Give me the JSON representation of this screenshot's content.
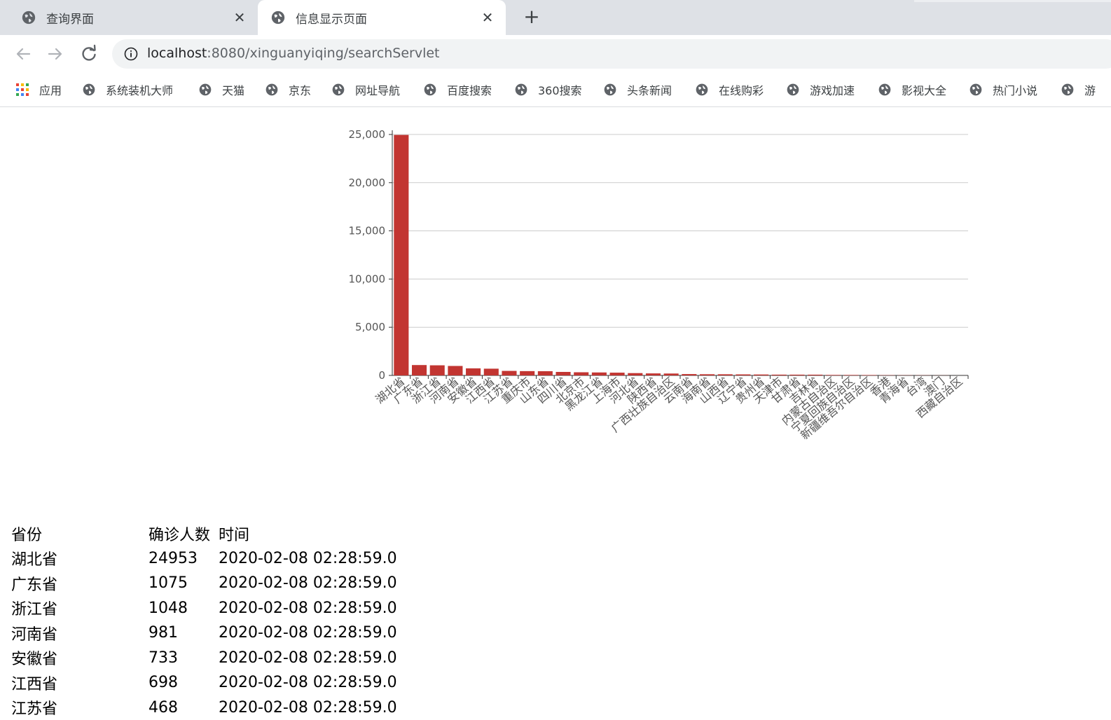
{
  "tabs": [
    {
      "title": "查询界面",
      "close": "✕"
    },
    {
      "title": "信息显示页面",
      "close": "✕"
    }
  ],
  "new_tab": "+",
  "address": {
    "host": "localhost",
    "rest": ":8080/xinguanyiqing/searchServlet"
  },
  "bookmarks": [
    {
      "label": "应用",
      "icon": "apps-grid-icon"
    },
    {
      "label": "系统装机大师",
      "icon": "globe-icon"
    },
    {
      "label": "天猫",
      "icon": "globe-icon"
    },
    {
      "label": "京东",
      "icon": "globe-icon"
    },
    {
      "label": "网址导航",
      "icon": "globe-icon"
    },
    {
      "label": "百度搜索",
      "icon": "globe-icon"
    },
    {
      "label": "360搜索",
      "icon": "globe-icon"
    },
    {
      "label": "头条新闻",
      "icon": "globe-icon"
    },
    {
      "label": "在线购彩",
      "icon": "globe-icon"
    },
    {
      "label": "游戏加速",
      "icon": "globe-icon"
    },
    {
      "label": "影视大全",
      "icon": "globe-icon"
    },
    {
      "label": "热门小说",
      "icon": "globe-icon"
    },
    {
      "label": "游",
      "icon": "globe-icon"
    }
  ],
  "chart_data": {
    "type": "bar",
    "ylim": [
      0,
      25000
    ],
    "yticks": [
      "0",
      "5,000",
      "10,000",
      "15,000",
      "20,000",
      "25,000"
    ],
    "grid": true,
    "bar_color": "#c23531",
    "categories": [
      "湖北省",
      "广东省",
      "浙江省",
      "河南省",
      "安徽省",
      "江西省",
      "江苏省",
      "重庆市",
      "山东省",
      "四川省",
      "北京市",
      "黑龙江省",
      "上海市",
      "河北省",
      "陕西省",
      "广西壮族自治区",
      "云南省",
      "海南省",
      "山西省",
      "辽宁省",
      "贵州省",
      "天津市",
      "甘肃省",
      "吉林省",
      "内蒙古自治区",
      "宁夏回族自治区",
      "新疆维吾尔自治区",
      "香港",
      "青海省",
      "台湾",
      "澳门",
      "西藏自治区"
    ],
    "values": [
      24953,
      1075,
      1048,
      981,
      733,
      698,
      468,
      446,
      435,
      363,
      326,
      307,
      286,
      239,
      208,
      195,
      140,
      122,
      119,
      107,
      96,
      81,
      79,
      78,
      52,
      49,
      42,
      26,
      18,
      17,
      10,
      1
    ]
  },
  "table": {
    "headers": [
      "省份",
      "确诊人数",
      "时间"
    ],
    "rows": [
      [
        "湖北省",
        "24953",
        "2020-02-08 02:28:59.0"
      ],
      [
        "广东省",
        "1075",
        "2020-02-08 02:28:59.0"
      ],
      [
        "浙江省",
        "1048",
        "2020-02-08 02:28:59.0"
      ],
      [
        "河南省",
        "981",
        "2020-02-08 02:28:59.0"
      ],
      [
        "安徽省",
        "733",
        "2020-02-08 02:28:59.0"
      ],
      [
        "江西省",
        "698",
        "2020-02-08 02:28:59.0"
      ],
      [
        "江苏省",
        "468",
        "2020-02-08 02:28:59.0"
      ]
    ]
  },
  "colors": {
    "tab_strip": "#dee1e6",
    "omnibox": "#f1f3f4",
    "bar": "#c23531"
  }
}
